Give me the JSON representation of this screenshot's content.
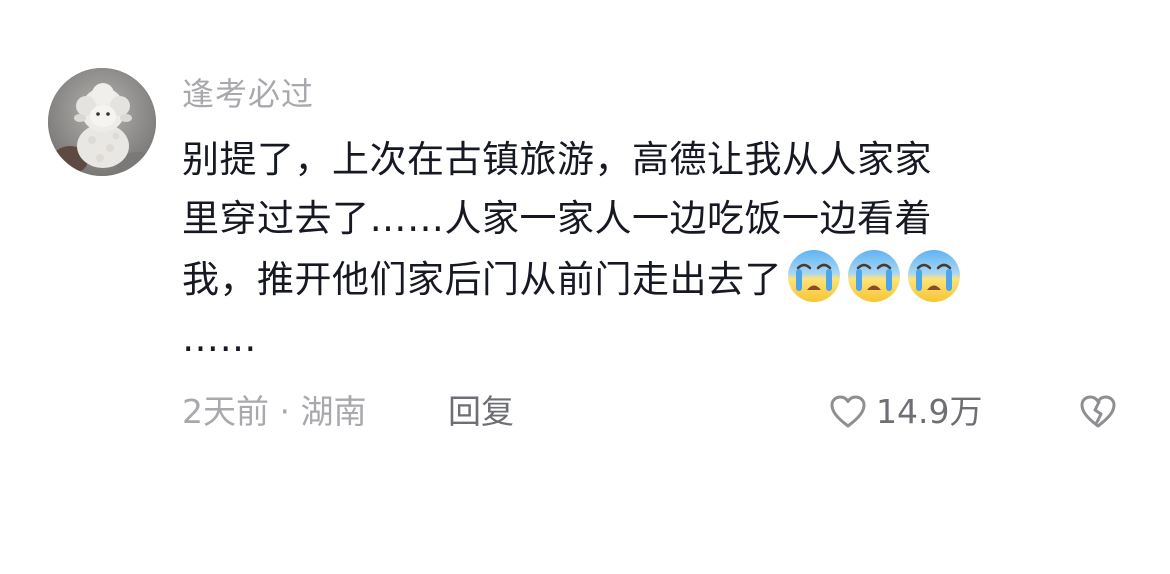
{
  "comment": {
    "username": "逢考必过",
    "avatar_icon": "sheep-plush-avatar",
    "content_lines": [
      "别提了，上次在古镇旅游，高德让我从人家家",
      "里穿过去了……人家一家人一边吃饭一边看着",
      "我，推开他们家后门从前门走出去了",
      "……"
    ],
    "emojis": [
      "crying-face-emoji",
      "crying-face-emoji",
      "crying-face-emoji"
    ],
    "meta": "2天前 · 湖南",
    "reply_label": "回复",
    "like_count": "14.9万",
    "like_icon": "heart-outline-icon",
    "dislike_icon": "broken-heart-icon"
  },
  "colors": {
    "text_primary": "#161823",
    "text_secondary": "#a9a9ad",
    "action_text": "#6e6f75"
  }
}
